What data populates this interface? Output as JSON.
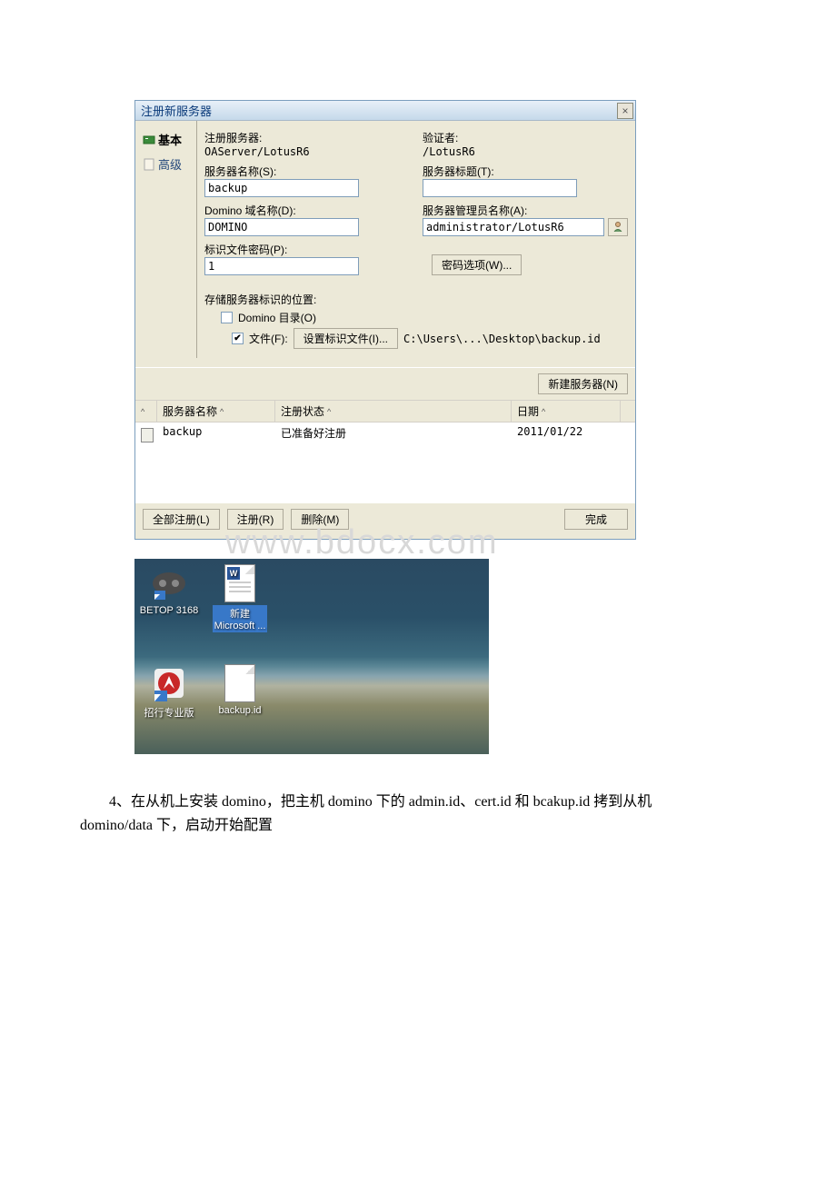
{
  "dialog": {
    "title": "注册新服务器",
    "close": "×"
  },
  "sidebar": {
    "basic": "基本",
    "advanced": "高级"
  },
  "form": {
    "reg_server_label": "注册服务器:",
    "reg_server_value": "OAServer/LotusR6",
    "certifier_label": "验证者:",
    "certifier_value": "/LotusR6",
    "server_name_label": "服务器名称(S):",
    "server_name_value": "backup",
    "server_title_label": "服务器标题(T):",
    "server_title_value": "",
    "domino_domain_label": "Domino 域名称(D):",
    "domino_domain_value": "DOMINO",
    "admin_name_label": "服务器管理员名称(A):",
    "admin_name_value": "administrator/LotusR6",
    "id_password_label": "标识文件密码(P):",
    "id_password_value": "1",
    "password_options": "密码选项(W)...",
    "storage_label": "存储服务器标识的位置:",
    "domino_dir": "Domino 目录(O)",
    "file_label": "文件(F):",
    "set_id_file": "设置标识文件(I)...",
    "id_path": "C:\\Users\\...\\Desktop\\backup.id",
    "new_server_btn": "新建服务器(N)"
  },
  "table": {
    "col1": "服务器名称",
    "col2": "注册状态",
    "col3": "日期",
    "row": {
      "name": "backup",
      "status": "已准备好注册",
      "date": "2011/01/22"
    }
  },
  "buttons": {
    "register_all": "全部注册(L)",
    "register": "注册(R)",
    "delete": "删除(M)",
    "done": "完成"
  },
  "watermark": "www.bdocx.com",
  "desktop": {
    "icon1": "BETOP 3168",
    "icon2_l1": "新建",
    "icon2_l2": "Microsoft ...",
    "icon3": "招行专业版",
    "icon4": "backup.id"
  },
  "body_text": "　　4、在从机上安装 domino，把主机 domino 下的 admin.id、cert.id 和 bcakup.id 拷到从机 domino/data 下，启动开始配置"
}
